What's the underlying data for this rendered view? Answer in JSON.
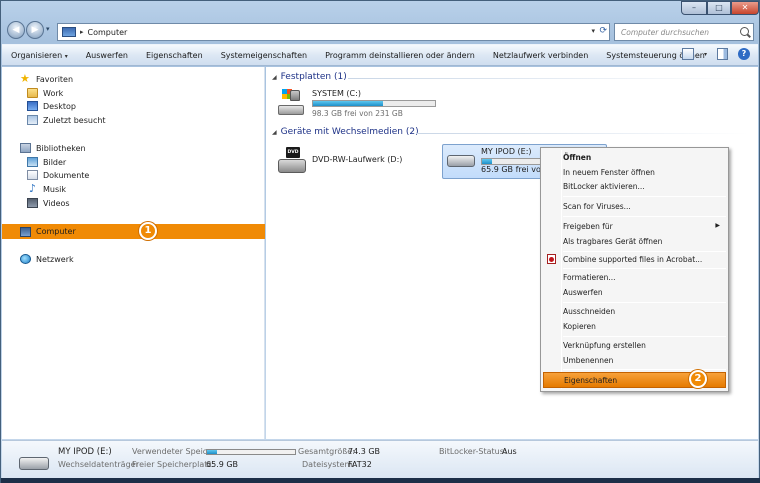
{
  "address": {
    "path": "Computer",
    "search_placeholder": "Computer durchsuchen"
  },
  "toolbar": {
    "items": [
      "Organisieren",
      "Auswerfen",
      "Eigenschaften",
      "Systemeigenschaften",
      "Programm deinstallieren oder ändern",
      "Netzlaufwerk verbinden",
      "Systemsteuerung öffnen"
    ],
    "organize_arrow": "▾"
  },
  "nav": {
    "favorites": "Favoriten",
    "work": "Work",
    "desktop": "Desktop",
    "recent": "Zuletzt besucht",
    "libraries": "Bibliotheken",
    "pictures": "Bilder",
    "documents": "Dokumente",
    "music": "Musik",
    "videos": "Videos",
    "computer": "Computer",
    "network": "Netzwerk"
  },
  "badges": {
    "one": "1",
    "two": "2"
  },
  "groups": {
    "hdd": "Festplatten (1)",
    "removable": "Geräte mit Wechselmedien (2)"
  },
  "drives": {
    "c": {
      "name": "SYSTEM (C:)",
      "free": "98.3 GB frei von 231 GB",
      "used_fraction": 0.57
    },
    "dvd": {
      "name": "DVD-RW-Laufwerk (D:)",
      "tag": "DVD"
    },
    "ipod": {
      "name": "MY IPOD (E:)",
      "free": "65.9 GB frei von 7",
      "used_fraction": 0.11
    }
  },
  "context_menu": {
    "open": "Öffnen",
    "open_new_window": "In neuem Fenster öffnen",
    "bitlocker": "BitLocker aktivieren...",
    "scan": "Scan for Viruses...",
    "share": "Freigeben für",
    "portable": "Als tragbares Gerät öffnen",
    "acrobat": "Combine supported files in Acrobat...",
    "format": "Formatieren...",
    "eject": "Auswerfen",
    "cut": "Ausschneiden",
    "copy": "Kopieren",
    "shortcut": "Verknüpfung erstellen",
    "rename": "Umbenennen",
    "properties": "Eigenschaften"
  },
  "status": {
    "name": "MY IPOD (E:)",
    "type": "Wechseldatenträger",
    "used_label": "Verwendeter Speic...",
    "used_fraction": 0.11,
    "free_label": "Freier Speicherplatz:",
    "free_value": "65.9 GB",
    "total_label": "Gesamtgröße:",
    "total_value": "74.3 GB",
    "fs_label": "Dateisystem:",
    "fs_value": "FAT32",
    "bitlocker_label": "BitLocker-Status:",
    "bitlocker_value": "Aus"
  }
}
